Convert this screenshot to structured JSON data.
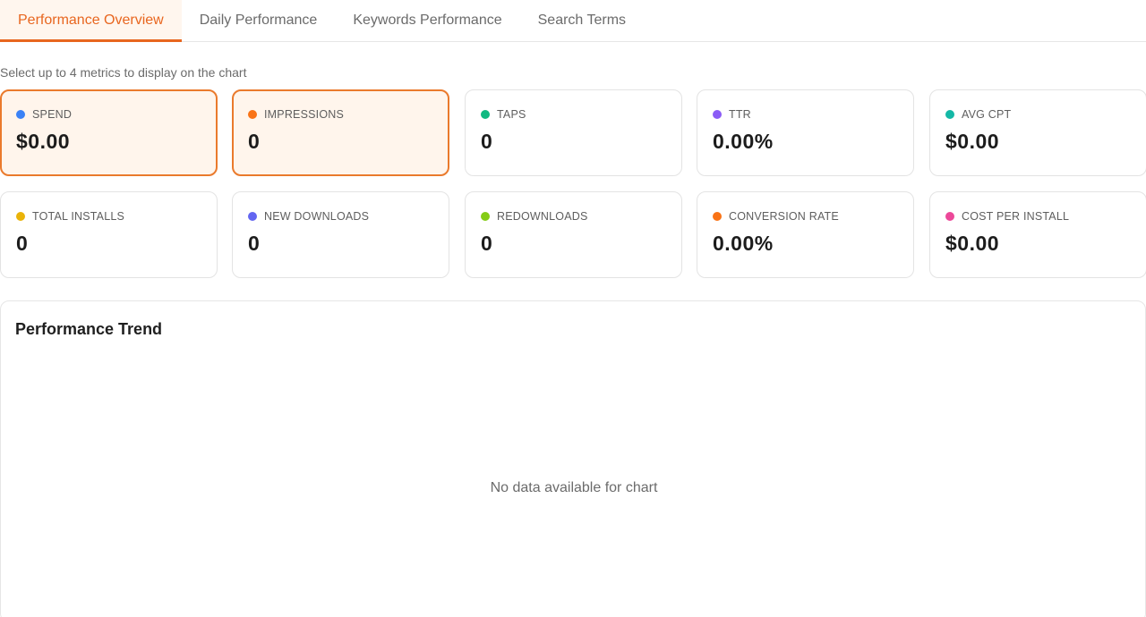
{
  "tabs": [
    {
      "label": "Performance Overview",
      "active": true
    },
    {
      "label": "Daily Performance",
      "active": false
    },
    {
      "label": "Keywords Performance",
      "active": false
    },
    {
      "label": "Search Terms",
      "active": false
    }
  ],
  "hint": "Select up to 4 metrics to display on the chart",
  "metrics": [
    {
      "label": "SPEND",
      "value": "$0.00",
      "color": "#3b82f6",
      "selected": true
    },
    {
      "label": "IMPRESSIONS",
      "value": "0",
      "color": "#f97316",
      "selected": true
    },
    {
      "label": "TAPS",
      "value": "0",
      "color": "#10b981",
      "selected": false
    },
    {
      "label": "TTR",
      "value": "0.00%",
      "color": "#8b5cf6",
      "selected": false
    },
    {
      "label": "AVG CPT",
      "value": "$0.00",
      "color": "#14b8a6",
      "selected": false
    },
    {
      "label": "TOTAL INSTALLS",
      "value": "0",
      "color": "#eab308",
      "selected": false
    },
    {
      "label": "NEW DOWNLOADS",
      "value": "0",
      "color": "#6366f1",
      "selected": false
    },
    {
      "label": "REDOWNLOADS",
      "value": "0",
      "color": "#84cc16",
      "selected": false
    },
    {
      "label": "CONVERSION RATE",
      "value": "0.00%",
      "color": "#f97316",
      "selected": false
    },
    {
      "label": "COST PER INSTALL",
      "value": "$0.00",
      "color": "#ec4899",
      "selected": false
    }
  ],
  "chart": {
    "title": "Performance Trend",
    "empty_message": "No data available for chart"
  }
}
